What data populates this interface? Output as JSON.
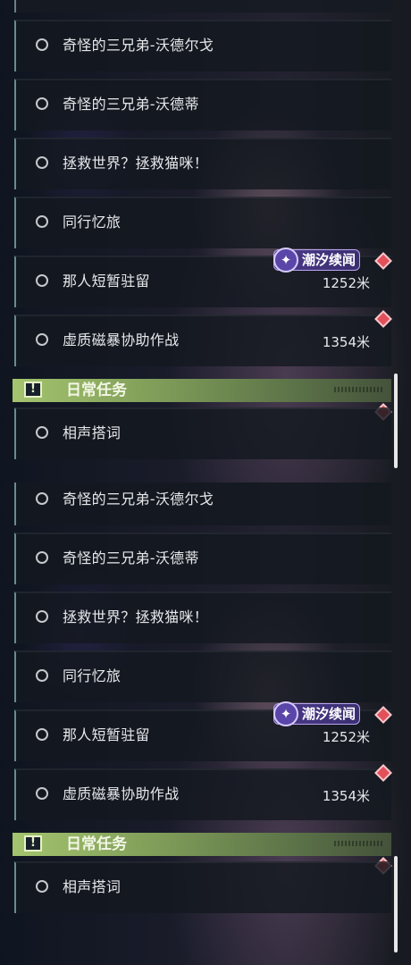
{
  "panels": [
    {
      "tasks": [
        {
          "title": "奇怪的三兄弟-沃德尔戈",
          "distance": ""
        },
        {
          "title": "奇怪的三兄弟-沃德蒂",
          "distance": ""
        },
        {
          "title": "拯救世界？拯救猫咪！",
          "distance": ""
        },
        {
          "title": "同行忆旅",
          "distance": ""
        },
        {
          "title": "那人短暂驻留",
          "distance": "1252米",
          "badge": "潮汐续闻"
        },
        {
          "title": "虚质磁暴协助作战",
          "distance": "1354米"
        }
      ],
      "section": {
        "title": "日常任务",
        "icon": "exclamation-icon"
      },
      "daily_tasks": [
        {
          "title": "相声搭词"
        }
      ]
    },
    {
      "tasks": [
        {
          "title": "奇怪的三兄弟-沃德尔戈",
          "distance": ""
        },
        {
          "title": "奇怪的三兄弟-沃德蒂",
          "distance": ""
        },
        {
          "title": "拯救世界？拯救猫咪！",
          "distance": ""
        },
        {
          "title": "同行忆旅",
          "distance": ""
        },
        {
          "title": "那人短暂驻留",
          "distance": "1252米",
          "badge": "潮汐续闻"
        },
        {
          "title": "虚质磁暴协助作战",
          "distance": "1354米"
        }
      ],
      "section": {
        "title": "日常任务",
        "icon": "exclamation-icon"
      },
      "daily_tasks": [
        {
          "title": "相声搭词"
        }
      ]
    }
  ],
  "colors": {
    "section_accent": "#a4c46e",
    "badge_purple": "#4c3a8a",
    "tracking_marker": "#e2505a"
  }
}
